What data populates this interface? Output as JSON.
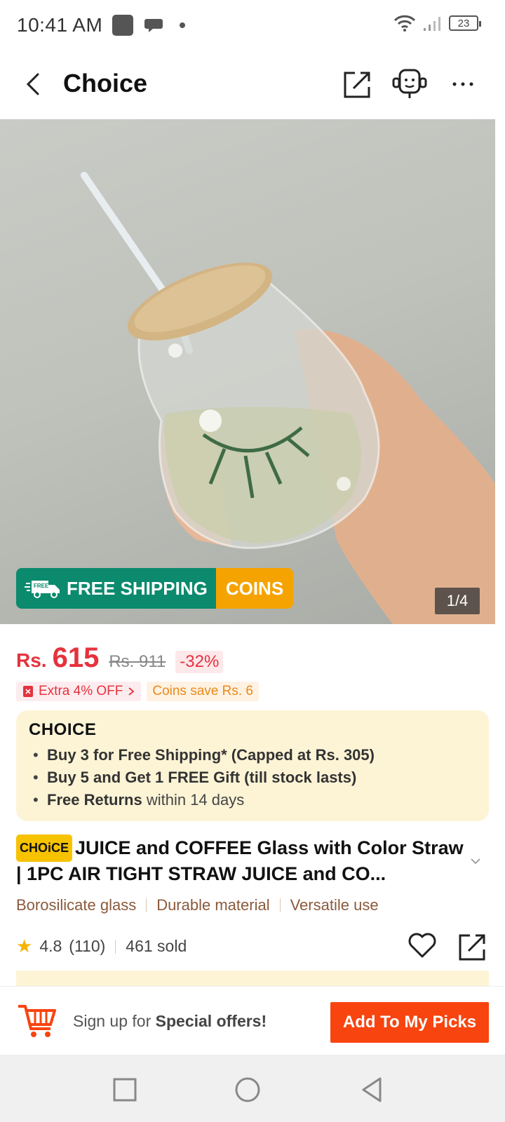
{
  "status_bar": {
    "time": "10:41 AM",
    "battery": "23"
  },
  "header": {
    "title": "Choice"
  },
  "gallery": {
    "banner_left": "FREE SHIPPING",
    "banner_free_tag": "FREE",
    "banner_right": "COINS",
    "pager": "1/4"
  },
  "price": {
    "currency": "Rs.",
    "value": "615",
    "original": "Rs. 911",
    "discount": "-32%"
  },
  "promos": {
    "extra": "Extra 4% OFF",
    "coins": "Coins save Rs. 6"
  },
  "choice_box": {
    "logo": "CHOICE",
    "items": [
      {
        "bold": "Buy 3 for  Free Shipping* (Capped at Rs. 305)",
        "rest": ""
      },
      {
        "bold": "Buy 5 and Get 1 FREE Gift (till stock lasts)",
        "rest": ""
      },
      {
        "bold": "Free Returns",
        "rest": " within 14 days"
      }
    ]
  },
  "product": {
    "badge": "CHOiCE",
    "title": "JUICE and COFFEE Glass with Color Straw | 1PC AIR TIGHT STRAW JUICE and CO...",
    "features": [
      "Borosilicate glass",
      "Durable material",
      "Versatile use"
    ],
    "rating": "4.8",
    "reviews": "(110)",
    "sold": "461 sold"
  },
  "bottom_bar": {
    "signup_prefix": "Sign up for ",
    "signup_bold": "Special offers!",
    "add_button": "Add To My Picks"
  },
  "colors": {
    "accent": "#f8440f",
    "price": "#e5323d",
    "shipping": "#0b8a6e",
    "coins": "#f5a300",
    "choice_bg": "#fdf4d6"
  }
}
